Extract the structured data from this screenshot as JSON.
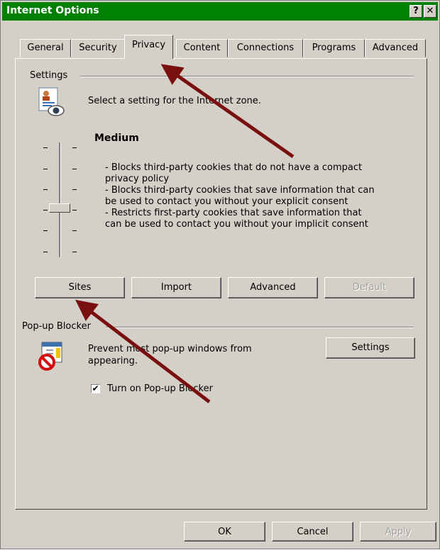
{
  "window": {
    "title": "Internet Options",
    "help_glyph": "?",
    "close_glyph": "✕"
  },
  "tabs": [
    {
      "label": "General"
    },
    {
      "label": "Security"
    },
    {
      "label": "Privacy"
    },
    {
      "label": "Content"
    },
    {
      "label": "Connections"
    },
    {
      "label": "Programs"
    },
    {
      "label": "Advanced"
    }
  ],
  "settings": {
    "group_title": "Settings",
    "zone_text": "Select a setting for the Internet zone.",
    "level": "Medium",
    "description": [
      "- Blocks third-party cookies that do not have a compact",
      "privacy policy",
      "- Blocks third-party cookies that save information that can",
      "be used to contact you without your explicit consent",
      "- Restricts first-party cookies that save information that",
      "can be used to contact you without your implicit consent"
    ],
    "buttons": {
      "sites": "Sites",
      "import": "Import",
      "advanced": "Advanced",
      "default": "Default"
    }
  },
  "popup": {
    "group_title": "Pop-up Blocker",
    "line1": "Prevent most pop-up windows from",
    "line2": "appearing.",
    "settings_button": "Settings",
    "checkbox_label": "Turn on Pop-up Blocker",
    "checkbox_mark": "✔"
  },
  "footer": {
    "ok": "OK",
    "cancel": "Cancel",
    "apply": "Apply"
  },
  "colors": {
    "titlebar": "#008000",
    "dialog": "#d4d0c8",
    "arrow": "#7a0f0f"
  }
}
